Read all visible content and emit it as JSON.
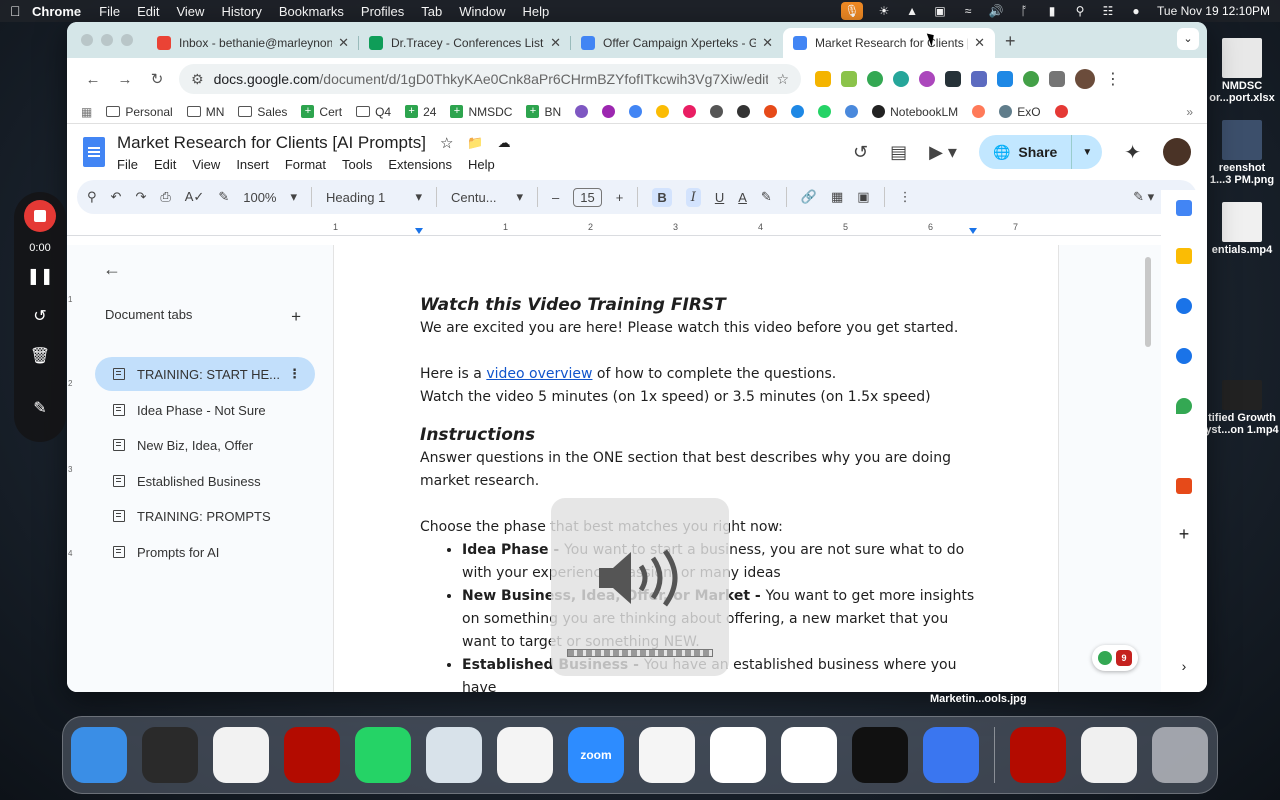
{
  "menubar": {
    "app": "Chrome",
    "items": [
      "File",
      "Edit",
      "View",
      "History",
      "Bookmarks",
      "Profiles",
      "Tab",
      "Window",
      "Help"
    ],
    "clock": "Tue Nov 19  12:10PM"
  },
  "desktop": {
    "items": [
      {
        "label": "NMDSC\nor...port.xlsx"
      },
      {
        "label": "reenshot\n1...3 PM.png"
      },
      {
        "label": "entials.mp4"
      },
      {
        "label": "tified Growth\nyst...on 1.mp4"
      }
    ],
    "file_label": "Marketin...ools.jpg"
  },
  "browser": {
    "tabs": [
      {
        "label": "Inbox - bethanie@marleynon",
        "color": "#ea4335",
        "active": false
      },
      {
        "label": "Dr.Tracey - Conferences List",
        "color": "#0f9d58",
        "active": false
      },
      {
        "label": "Offer Campaign Xperteks - G",
        "color": "#4285f4",
        "active": false
      },
      {
        "label": "Market Research for Clients [",
        "color": "#4285f4",
        "active": true
      }
    ],
    "url_domain": "docs.google.com",
    "url_path": "/document/d/1gD0ThkyKAe0Cnk8aPr6CHrmBZYfofITkcwih3Vg7Xiw/edit?t...",
    "bookmarks": [
      {
        "label": "Personal",
        "type": "folder"
      },
      {
        "label": "MN",
        "type": "folder"
      },
      {
        "label": "Sales",
        "type": "folder"
      },
      {
        "label": "Cert",
        "type": "sheet"
      },
      {
        "label": "Q4",
        "type": "folder"
      },
      {
        "label": "24",
        "type": "sheet"
      },
      {
        "label": "NMSDC",
        "type": "sheet"
      },
      {
        "label": "BN",
        "type": "sheet"
      },
      {
        "label": "NotebookLM",
        "type": "site"
      },
      {
        "label": "ExO",
        "type": "site"
      }
    ]
  },
  "docs": {
    "title": "Market Research for Clients [AI Prompts]",
    "menu": [
      "File",
      "Edit",
      "View",
      "Insert",
      "Format",
      "Tools",
      "Extensions",
      "Help"
    ],
    "share_label": "Share",
    "toolbar": {
      "zoom": "100%",
      "style": "Heading 1",
      "font": "Centu...",
      "size": "15"
    },
    "ruler": [
      "1",
      "1",
      "2",
      "3",
      "4",
      "5",
      "6",
      "7"
    ],
    "vruler": [
      "1",
      "2",
      "3",
      "4"
    ],
    "sidebar": {
      "header": "Document tabs",
      "tabs": [
        {
          "label": "TRAINING: START HE...",
          "active": true
        },
        {
          "label": "Idea Phase - Not Sure",
          "active": false
        },
        {
          "label": "New Biz, Idea, Offer",
          "active": false
        },
        {
          "label": "Established Business",
          "active": false
        },
        {
          "label": "TRAINING: PROMPTS",
          "active": false
        },
        {
          "label": "Prompts for AI",
          "active": false
        }
      ]
    },
    "content": {
      "h1": "Watch this Video Training FIRST",
      "p1": "We are excited you are here! Please watch this video before you get started.",
      "p2_pre": "Here is a ",
      "p2_link": "video overview",
      "p2_post": " of how to complete the questions.",
      "p3": "Watch the video 5 minutes (on 1x speed) or 3.5 minutes (on 1.5x speed)",
      "h2": "Instructions",
      "p4": "Answer questions in the ONE section that best describes why you are doing market research.",
      "p5": "Choose the phase that best matches you right now:",
      "bullets": [
        {
          "bold": "Idea Phase - ",
          "text": "You want to start a business, you are not sure what to do with your experience, passion, or many ideas"
        },
        {
          "bold": "New Business, Idea, Offer, or Market - ",
          "text": "You want to get more insights on something you are thinking about offering, a new market that you want to target or something NEW."
        },
        {
          "bold": "Established Business - ",
          "text": "You have an established business where you have"
        }
      ]
    },
    "badge_count": "9"
  },
  "recorder": {
    "time": "0:00"
  },
  "dock": {
    "apps": [
      {
        "name": "finder",
        "color": "#3a8ee6",
        "label": ""
      },
      {
        "name": "quicktime",
        "color": "#2a2a2a",
        "label": ""
      },
      {
        "name": "preview",
        "color": "#f2f2f2",
        "label": ""
      },
      {
        "name": "acrobat",
        "color": "#b30b00",
        "label": ""
      },
      {
        "name": "whatsapp",
        "color": "#25d366",
        "label": ""
      },
      {
        "name": "photo-app",
        "color": "#d8e2ea",
        "label": ""
      },
      {
        "name": "textedit",
        "color": "#f4f4f4",
        "label": ""
      },
      {
        "name": "zoom",
        "color": "#2d8cff",
        "label": "zoom"
      },
      {
        "name": "messenger",
        "color": "#f5f5f5",
        "label": ""
      },
      {
        "name": "perplexity",
        "color": "#ffffff",
        "label": ""
      },
      {
        "name": "chrome",
        "color": "#ffffff",
        "label": ""
      },
      {
        "name": "mural",
        "color": "#111111",
        "label": ""
      },
      {
        "name": "signal",
        "color": "#3a76f0",
        "label": ""
      }
    ]
  }
}
